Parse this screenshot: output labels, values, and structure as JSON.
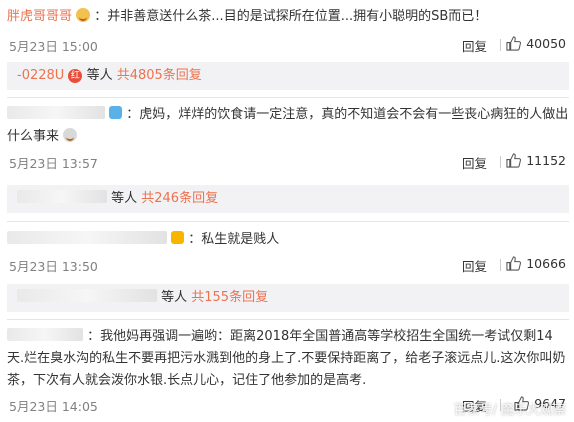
{
  "comments": [
    {
      "user": "胖虎哥哥哥",
      "text": "：并非善意送什么茶...目的是试探所在位置...拥有小聪明的SB而已！",
      "time": "5月23日 15:00",
      "reply": "回复",
      "likes": "40050"
    },
    {
      "text": "：虎妈，烊烊的饮食请一定注意，真的不知道会不会有一些丧心病狂的人做出什么事来",
      "time": "5月23日 13:57",
      "reply": "回复",
      "likes": "11152"
    },
    {
      "text": "：私生就是贱人",
      "time": "5月23日 13:50",
      "reply": "回复",
      "likes": "10666"
    },
    {
      "text": "：我他妈再强调一遍哟：距离2018年全国普通高等学校招生全国统一考试仅剩14天.烂在臭水沟的私生不要再把污水溅到他的身上了.不要保持距离了，给老子滚远点儿.这次你叫奶茶，下次有人就会泼你水银.长点儿心，记住了他参加的是高考.",
      "time": "5月23日 14:05",
      "reply": "回复",
      "likes": "9647"
    }
  ],
  "subreplies": [
    {
      "user": "-0228U",
      "badge": "红",
      "middle": " 等人 ",
      "more": "共4805条回复"
    },
    {
      "middle": " 等人 ",
      "more": "共246条回复"
    },
    {
      "middle": " 等人 ",
      "more": "共155条回复"
    }
  ],
  "watermark": "百家号/ 魔乐大观察",
  "colors": {
    "accent": "#eb7350",
    "subbox_bg": "#f2f2f5"
  },
  "icons": [
    "thumb-up-icon",
    "emoji-icon",
    "vip-icon"
  ]
}
